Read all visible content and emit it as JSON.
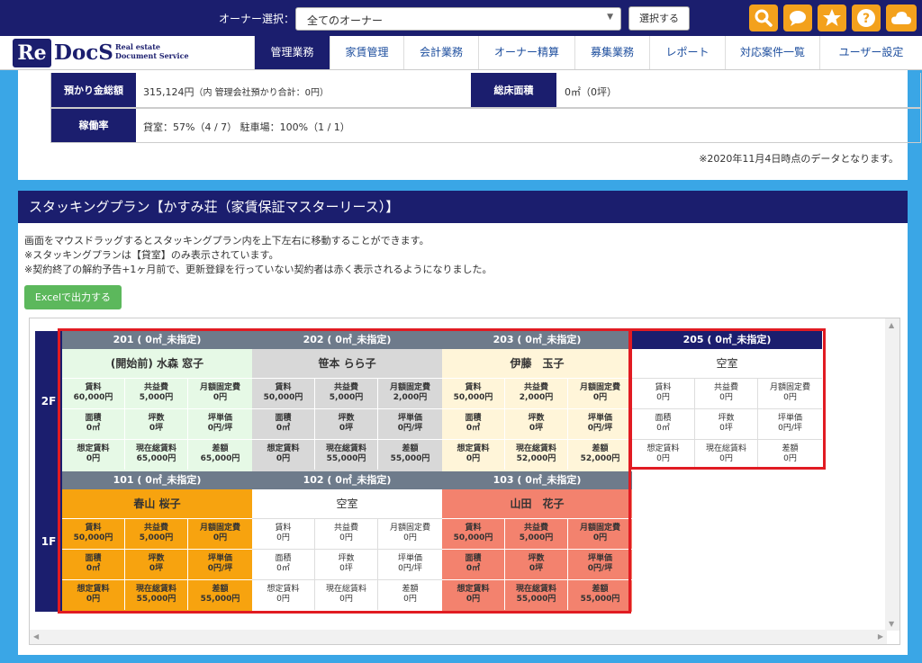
{
  "topbar": {
    "owner_label": "オーナー選択：",
    "owner_select_value": "全てのオーナー",
    "select_button": "選択する",
    "icons": [
      "search-icon",
      "chat-icon",
      "star-icon",
      "help-icon",
      "cloud-icon"
    ],
    "accent_color": "#f3a11c",
    "brand_color": "#1b1e6e"
  },
  "logo": {
    "re": "Re",
    "docs": "DocS",
    "sub_line1": "Real estate",
    "sub_line2": "Document Service"
  },
  "nav": {
    "items": [
      "管理業務",
      "家賃管理",
      "会計業務",
      "オーナー精算",
      "募集業務",
      "レポート",
      "対応案件一覧",
      "ユーザー設定"
    ],
    "active_index": 0
  },
  "summary": {
    "deposit_label": "預かり金総額",
    "deposit_value": "315,124円",
    "deposit_note": "（内 管理会社預かり合計：0円）",
    "floor_area_label": "総床面積",
    "floor_area_value": "0㎡（0坪）",
    "occupancy_label": "稼働率",
    "occupancy_value": "貸室：57%（4 / 7）  駐車場：100%（1 / 1）",
    "data_date_note": "※2020年11月4日時点のデータとなります。"
  },
  "stacking": {
    "title": "スタッキングプラン【かすみ荘（家賃保証マスターリース）】",
    "notes": [
      "画面をマウスドラッグするとスタッキングプラン内を上下左右に移動することができます。",
      "※スタッキングプランは【貸室】のみ表示されています。",
      "※契約終了の解約予告+1ヶ月前で、更新登録を行っていない契約者は赤く表示されるようになりました。"
    ],
    "excel_button": "Excelで出力する",
    "floors": [
      "2F",
      "1F"
    ],
    "units": [
      {
        "id": "201",
        "header": "201 ( 0㎡_未指定)",
        "tenant": "(開始前) 水森 窓子",
        "status": "pre-start",
        "color": "#e6f9e6",
        "cells": [
          [
            "賃料",
            "60,000円"
          ],
          [
            "共益費",
            "5,000円"
          ],
          [
            "月額固定費",
            "0円"
          ],
          [
            "面積",
            "0㎡"
          ],
          [
            "坪数",
            "0坪"
          ],
          [
            "坪単価",
            "0円/坪"
          ],
          [
            "想定賃料",
            "0円"
          ],
          [
            "現在総賃料",
            "65,000円"
          ],
          [
            "差額",
            "65,000円"
          ]
        ]
      },
      {
        "id": "202",
        "header": "202 ( 0㎡_未指定)",
        "tenant": "笹本 らら子",
        "status": "occupied",
        "color": "#d8d8d8",
        "cells": [
          [
            "賃料",
            "50,000円"
          ],
          [
            "共益費",
            "5,000円"
          ],
          [
            "月額固定費",
            "2,000円"
          ],
          [
            "面積",
            "0㎡"
          ],
          [
            "坪数",
            "0坪"
          ],
          [
            "坪単価",
            "0円/坪"
          ],
          [
            "想定賃料",
            "0円"
          ],
          [
            "現在総賃料",
            "55,000円"
          ],
          [
            "差額",
            "55,000円"
          ]
        ]
      },
      {
        "id": "203",
        "header": "203 ( 0㎡_未指定)",
        "tenant": "伊藤　玉子",
        "status": "occupied",
        "color": "#fff5d9",
        "cells": [
          [
            "賃料",
            "50,000円"
          ],
          [
            "共益費",
            "2,000円"
          ],
          [
            "月額固定費",
            "0円"
          ],
          [
            "面積",
            "0㎡"
          ],
          [
            "坪数",
            "0坪"
          ],
          [
            "坪単価",
            "0円/坪"
          ],
          [
            "想定賃料",
            "0円"
          ],
          [
            "現在総賃料",
            "52,000円"
          ],
          [
            "差額",
            "52,000円"
          ]
        ]
      },
      {
        "id": "205",
        "header": "205 ( 0㎡_未指定)",
        "tenant": "空室",
        "status": "vacant",
        "color": "#ffffff",
        "cells": [
          [
            "賃料",
            "0円"
          ],
          [
            "共益費",
            "0円"
          ],
          [
            "月額固定費",
            "0円"
          ],
          [
            "面積",
            "0㎡"
          ],
          [
            "坪数",
            "0坪"
          ],
          [
            "坪単価",
            "0円/坪"
          ],
          [
            "想定賃料",
            "0円"
          ],
          [
            "現在総賃料",
            "0円"
          ],
          [
            "差額",
            "0円"
          ]
        ]
      },
      {
        "id": "101",
        "header": "101 ( 0㎡_未指定)",
        "tenant": "春山 桜子",
        "status": "occupied",
        "color": "#f7a30f",
        "cells": [
          [
            "賃料",
            "50,000円"
          ],
          [
            "共益費",
            "5,000円"
          ],
          [
            "月額固定費",
            "0円"
          ],
          [
            "面積",
            "0㎡"
          ],
          [
            "坪数",
            "0坪"
          ],
          [
            "坪単価",
            "0円/坪"
          ],
          [
            "想定賃料",
            "0円"
          ],
          [
            "現在総賃料",
            "55,000円"
          ],
          [
            "差額",
            "55,000円"
          ]
        ]
      },
      {
        "id": "102",
        "header": "102 ( 0㎡_未指定)",
        "tenant": "空室",
        "status": "vacant",
        "color": "#ffffff",
        "cells": [
          [
            "賃料",
            "0円"
          ],
          [
            "共益費",
            "0円"
          ],
          [
            "月額固定費",
            "0円"
          ],
          [
            "面積",
            "0㎡"
          ],
          [
            "坪数",
            "0坪"
          ],
          [
            "坪単価",
            "0円/坪"
          ],
          [
            "想定賃料",
            "0円"
          ],
          [
            "現在総賃料",
            "0円"
          ],
          [
            "差額",
            "0円"
          ]
        ]
      },
      {
        "id": "103",
        "header": "103 ( 0㎡_未指定)",
        "tenant": "山田　花子",
        "status": "expiring",
        "color": "#f3826e",
        "cells": [
          [
            "賃料",
            "50,000円"
          ],
          [
            "共益費",
            "5,000円"
          ],
          [
            "月額固定費",
            "0円"
          ],
          [
            "面積",
            "0㎡"
          ],
          [
            "坪数",
            "0坪"
          ],
          [
            "坪単価",
            "0円/坪"
          ],
          [
            "想定賃料",
            "0円"
          ],
          [
            "現在総賃料",
            "55,000円"
          ],
          [
            "差額",
            "55,000円"
          ]
        ]
      }
    ]
  }
}
